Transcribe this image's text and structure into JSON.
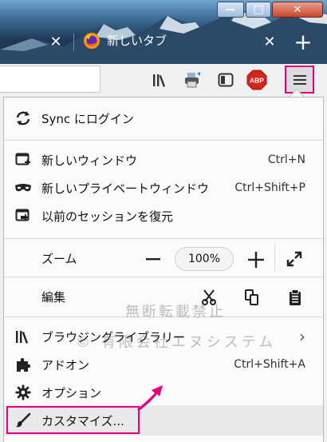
{
  "window": {
    "min_symbol": "—",
    "max_symbol": "□",
    "close_symbol": "✕"
  },
  "tab": {
    "title": "新しいタブ",
    "close_symbol": "✕",
    "new_tab_symbol": "+"
  },
  "toolbar": {
    "icons": [
      "library-icon",
      "print-icon",
      "sidebar-icon",
      "adblock-plus-icon",
      "hamburger-menu-icon"
    ],
    "abp_label": "ABP",
    "accent_color": "#e3007f"
  },
  "menu": {
    "sync": {
      "label": "Sync にログイン",
      "icon": "sync-icon"
    },
    "new_window": {
      "label": "新しいウィンドウ",
      "shortcut": "Ctrl+N",
      "icon": "new-window-icon"
    },
    "private_window": {
      "label": "新しいプライベートウィンドウ",
      "shortcut": "Ctrl+Shift+P",
      "icon": "mask-icon"
    },
    "restore_session": {
      "label": "以前のセッションを復元",
      "icon": "restore-icon"
    },
    "zoom": {
      "label": "ズーム",
      "value": "100%",
      "minus": "—",
      "plus": "+"
    },
    "edit": {
      "label": "編集",
      "icons": [
        "scissors-icon",
        "copy-icon",
        "paste-icon"
      ]
    },
    "library": {
      "label": "ブラウジングライブラリー",
      "arrow": "›",
      "icon": "library-icon"
    },
    "addons": {
      "label": "アドオン",
      "shortcut": "Ctrl+Shift+A",
      "icon": "puzzle-icon"
    },
    "options": {
      "label": "オプション",
      "icon": "gear-icon"
    },
    "customize": {
      "label": "カスタマイズ...",
      "icon": "brush-icon"
    }
  },
  "watermark": {
    "line1": "無断転載禁止",
    "line2": "© 有限会社エヌシステム"
  }
}
